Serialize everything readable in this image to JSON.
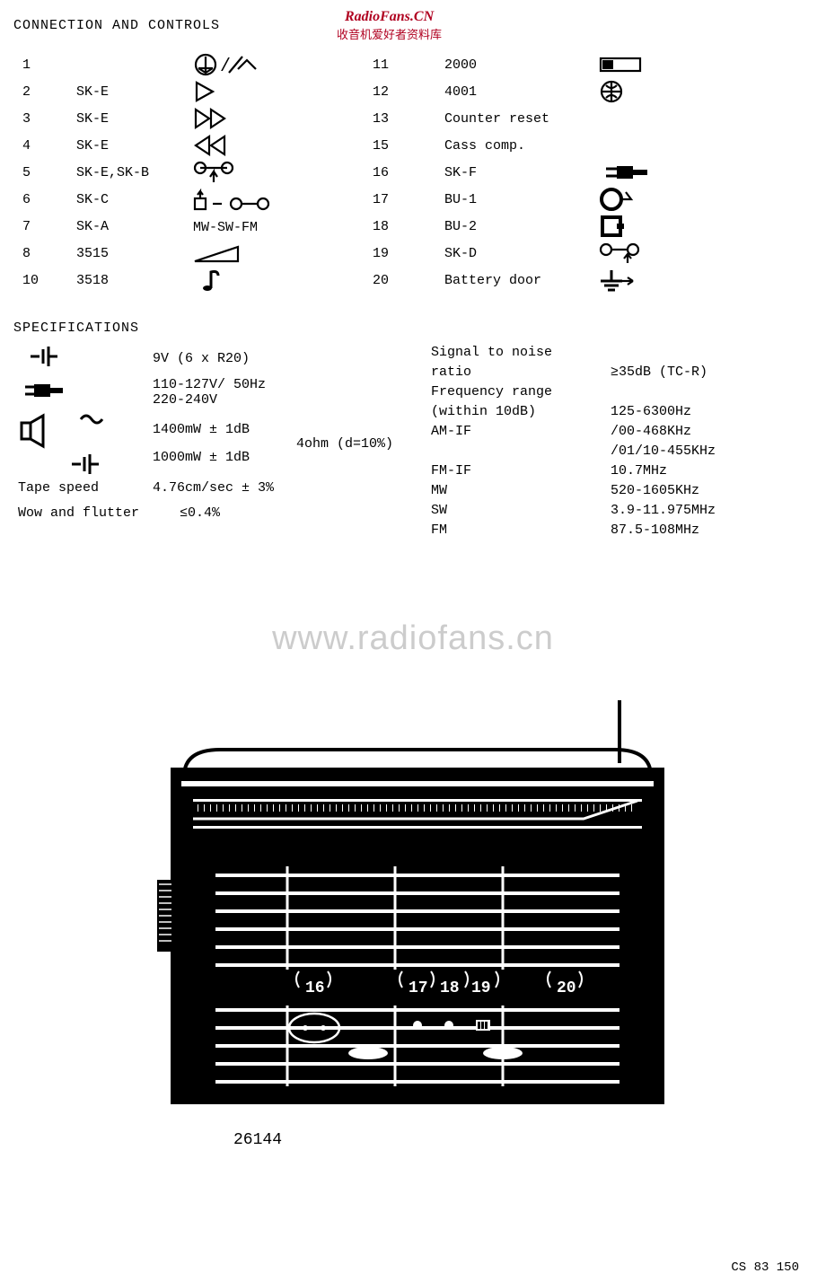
{
  "header": {
    "title": "CONNECTION AND CONTROLS",
    "brand": "RadioFans.CN",
    "brand_sub": "收音机爱好者资料库"
  },
  "controls_left": [
    {
      "num": "1",
      "code": "",
      "sym": "record"
    },
    {
      "num": "2",
      "code": "SK-E",
      "sym": "play"
    },
    {
      "num": "3",
      "code": "SK-E",
      "sym": "ff"
    },
    {
      "num": "4",
      "code": "SK-E",
      "sym": "rew"
    },
    {
      "num": "5",
      "code": "SK-E,SK-B",
      "sym": "pause"
    },
    {
      "num": "6",
      "code": "SK-C",
      "sym": "stop-eject"
    },
    {
      "num": "7",
      "code": "SK-A",
      "sym": "MW-SW-FM"
    },
    {
      "num": "8",
      "code": "3515",
      "sym": "volume"
    },
    {
      "num": "10",
      "code": "3518",
      "sym": "tone"
    }
  ],
  "controls_right": [
    {
      "num": "11",
      "code": "2000",
      "sym": "switch"
    },
    {
      "num": "12",
      "code": "4001",
      "sym": "jack"
    },
    {
      "num": "13",
      "code": "Counter reset",
      "sym": ""
    },
    {
      "num": "15",
      "code": "Cass comp.",
      "sym": ""
    },
    {
      "num": "16",
      "code": "SK-F",
      "sym": "plug"
    },
    {
      "num": "17",
      "code": "BU-1",
      "sym": "circle-socket"
    },
    {
      "num": "18",
      "code": "BU-2",
      "sym": "square-socket"
    },
    {
      "num": "19",
      "code": "SK-D",
      "sym": "tape-socket"
    },
    {
      "num": "20",
      "code": "Battery door",
      "sym": "ground"
    }
  ],
  "specs_title": "SPECIFICATIONS",
  "specs_left": [
    {
      "icon": "battery",
      "text": "9V (6 x R20)"
    },
    {
      "icon": "mains",
      "text": "110-127V/ 50Hz",
      "text2": "220-240V"
    },
    {
      "icon": "speaker-ac",
      "text": "1400mW ± 1dB",
      "side": "4ohm (d=10%)"
    },
    {
      "icon": "speaker-dc",
      "text": "1000mW ± 1dB"
    },
    {
      "icon": "",
      "label": "Tape speed",
      "text": "4.76cm/sec ± 3%"
    },
    {
      "icon": "",
      "label": "Wow and flutter",
      "text": "≤0.4%"
    }
  ],
  "specs_right_labels": [
    "Signal to noise",
    "ratio",
    "Frequency range",
    "(within 10dB)",
    "AM-IF",
    "",
    "FM-IF",
    "MW",
    "SW",
    "FM"
  ],
  "specs_right_values": [
    "",
    "≥35dB (TC-R)",
    "",
    "125-6300Hz",
    "/00-468KHz",
    "/01/10-455KHz",
    "10.7MHz",
    "520-1605KHz",
    "3.9-11.975MHz",
    "87.5-108MHz"
  ],
  "watermark": "www.radiofans.cn",
  "device": {
    "callouts": [
      "16",
      "17",
      "18",
      "19",
      "20"
    ],
    "model": "26144"
  },
  "footer": "CS 83 150"
}
